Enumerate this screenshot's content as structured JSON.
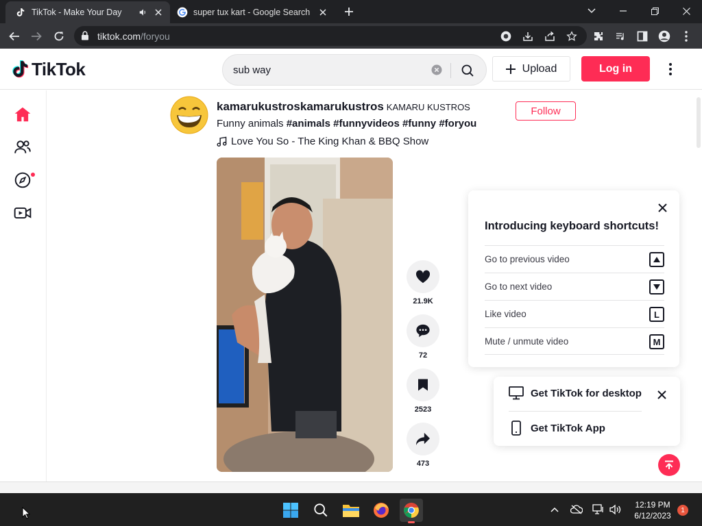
{
  "browser": {
    "tabs": [
      {
        "title": "TikTok - Make Your Day",
        "favicon": "tiktok-icon",
        "active": true,
        "audio": true
      },
      {
        "title": "super tux kart - Google Search",
        "favicon": "google-icon",
        "active": false
      }
    ],
    "url_domain": "tiktok.com",
    "url_path": "/foryou"
  },
  "header": {
    "logo_text": "TikTok",
    "search_value": "sub way",
    "upload_label": "Upload",
    "login_label": "Log in",
    "accent_color": "#fe2c55"
  },
  "sidebar": {
    "items": [
      {
        "name": "home-icon",
        "active": true
      },
      {
        "name": "following-icon"
      },
      {
        "name": "explore-icon",
        "badge": true
      },
      {
        "name": "live-icon"
      }
    ]
  },
  "post": {
    "username": "kamarukustroskamarukustros",
    "nickname": "KAMARU KUSTROS",
    "follow_label": "Follow",
    "caption": "Funny animals",
    "hashtags": [
      "#animals",
      "#funnyvideos",
      "#funny",
      "#foryou"
    ],
    "music": "Love You So - The King Khan & BBQ Show",
    "stats": {
      "likes": "21.9K",
      "comments": "72",
      "saves": "2523",
      "shares": "473"
    }
  },
  "shortcuts": {
    "title": "Introducing keyboard shortcuts!",
    "rows": [
      {
        "label": "Go to previous video",
        "key": "▲"
      },
      {
        "label": "Go to next video",
        "key": "▼"
      },
      {
        "label": "Like video",
        "key": "L"
      },
      {
        "label": "Mute / unmute video",
        "key": "M"
      }
    ]
  },
  "get_app": {
    "desktop_label": "Get TikTok for desktop",
    "app_label": "Get TikTok App"
  },
  "taskbar": {
    "time": "12:19 PM",
    "date": "6/12/2023",
    "notification_count": "1"
  }
}
